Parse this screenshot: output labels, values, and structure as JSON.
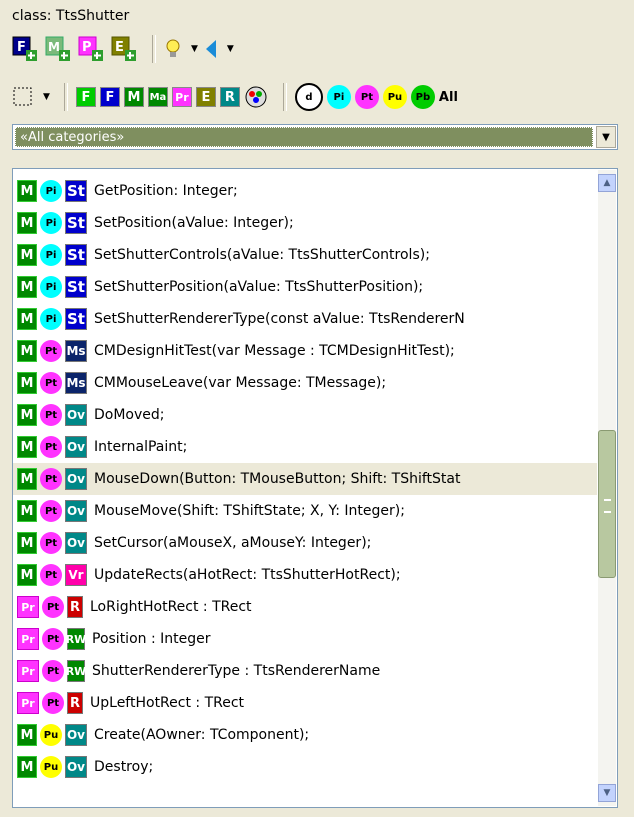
{
  "header": {
    "title": "class: TtsShutter"
  },
  "toolbar1": {
    "buttons": [
      {
        "name": "add-field-button",
        "label": "F",
        "color": "#00008b"
      },
      {
        "name": "add-method-button",
        "label": "M",
        "color": "#008800"
      },
      {
        "name": "add-property-button",
        "label": "P",
        "color": "#ff00ff"
      },
      {
        "name": "add-event-button",
        "label": "E",
        "color": "#808000"
      }
    ]
  },
  "toolbar2": {
    "filters": [
      {
        "name": "filter-field-private",
        "label": "F",
        "bg": "#00cc00"
      },
      {
        "name": "filter-field",
        "label": "F",
        "bg": "#0000cc"
      },
      {
        "name": "filter-method",
        "label": "M",
        "bg": "#008800"
      },
      {
        "name": "filter-message",
        "label": "Ma",
        "bg": "#008800"
      },
      {
        "name": "filter-property",
        "label": "Pr",
        "bg": "#ff33ff"
      },
      {
        "name": "filter-event",
        "label": "E",
        "bg": "#808000"
      },
      {
        "name": "filter-resource",
        "label": "R",
        "bg": "#008888"
      }
    ],
    "visibility": [
      {
        "name": "filter-default",
        "label": "d",
        "bg": "#ffffff"
      },
      {
        "name": "filter-private",
        "label": "Pi",
        "bg": "#00ffff"
      },
      {
        "name": "filter-protected",
        "label": "Pt",
        "bg": "#ff33ff"
      },
      {
        "name": "filter-public",
        "label": "Pu",
        "bg": "#ffff00"
      },
      {
        "name": "filter-published",
        "label": "Pb",
        "bg": "#00cc00"
      }
    ],
    "all_label": "All"
  },
  "category_combo": {
    "value": "«All categories»"
  },
  "members": [
    {
      "kind": "M",
      "vis": "Pi",
      "badge": "St",
      "text": "GetPosition: Integer;"
    },
    {
      "kind": "M",
      "vis": "Pi",
      "badge": "St",
      "text": "SetPosition(aValue: Integer);"
    },
    {
      "kind": "M",
      "vis": "Pi",
      "badge": "St",
      "text": "SetShutterControls(aValue: TtsShutterControls);"
    },
    {
      "kind": "M",
      "vis": "Pi",
      "badge": "St",
      "text": "SetShutterPosition(aValue: TtsShutterPosition);"
    },
    {
      "kind": "M",
      "vis": "Pi",
      "badge": "St",
      "text": "SetShutterRendererType(const aValue: TtsRendererN"
    },
    {
      "kind": "M",
      "vis": "Pt",
      "badge": "Ms",
      "text": "CMDesignHitTest(var Message : TCMDesignHitTest);"
    },
    {
      "kind": "M",
      "vis": "Pt",
      "badge": "Ms",
      "text": "CMMouseLeave(var Message: TMessage);"
    },
    {
      "kind": "M",
      "vis": "Pt",
      "badge": "Ov",
      "text": "DoMoved;"
    },
    {
      "kind": "M",
      "vis": "Pt",
      "badge": "Ov",
      "text": "InternalPaint;"
    },
    {
      "kind": "M",
      "vis": "Pt",
      "badge": "Ov",
      "text": "MouseDown(Button: TMouseButton; Shift: TShiftStat",
      "selected": true
    },
    {
      "kind": "M",
      "vis": "Pt",
      "badge": "Ov",
      "text": "MouseMove(Shift: TShiftState; X, Y: Integer);"
    },
    {
      "kind": "M",
      "vis": "Pt",
      "badge": "Ov",
      "text": "SetCursor(aMouseX, aMouseY: Integer);"
    },
    {
      "kind": "M",
      "vis": "Pt",
      "badge": "Vr",
      "text": "UpdateRects(aHotRect: TtsShutterHotRect);"
    },
    {
      "kind": "Pr",
      "vis": "Pt",
      "badge": "R",
      "text": "LoRightHotRect : TRect"
    },
    {
      "kind": "Pr",
      "vis": "Pt",
      "badge": "RW",
      "text": "Position : Integer"
    },
    {
      "kind": "Pr",
      "vis": "Pt",
      "badge": "RW",
      "text": "ShutterRendererType : TtsRendererName"
    },
    {
      "kind": "Pr",
      "vis": "Pt",
      "badge": "R",
      "text": "UpLeftHotRect : TRect"
    },
    {
      "kind": "M",
      "vis": "Pu",
      "badge": "Ov",
      "text": "Create(AOwner: TComponent);"
    },
    {
      "kind": "M",
      "vis": "Pu",
      "badge": "Ov",
      "text": "Destroy;"
    }
  ]
}
